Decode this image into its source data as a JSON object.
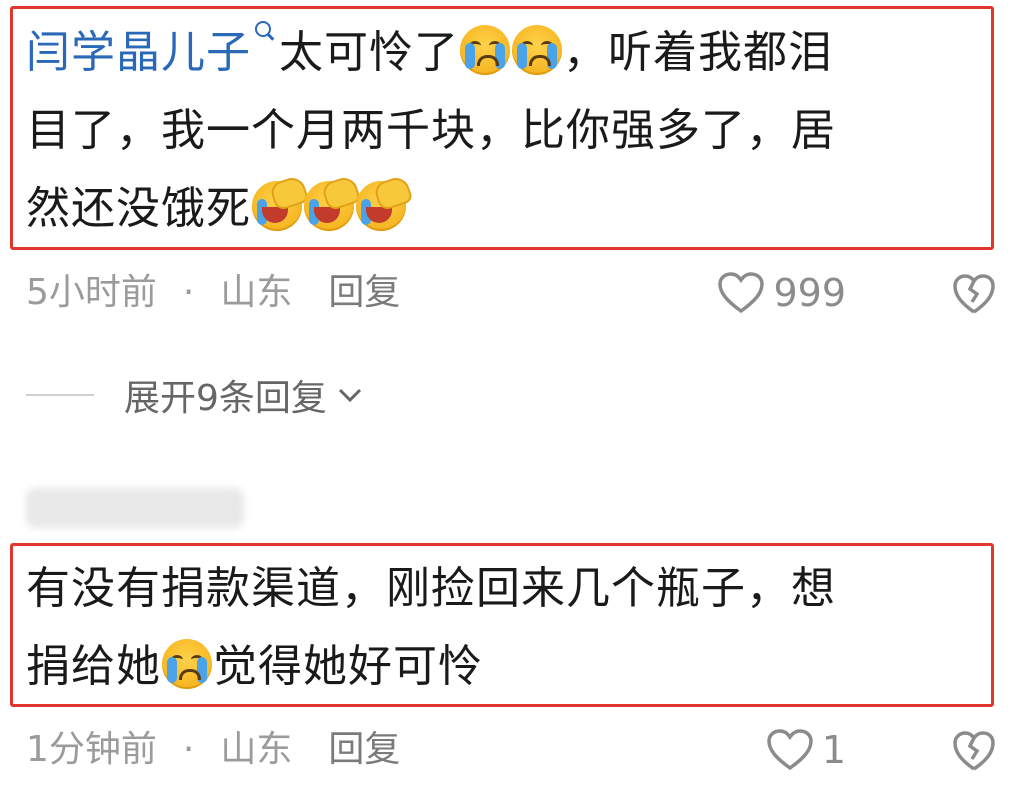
{
  "comment1": {
    "username": "闫学晶儿子",
    "line1_text": "太可怜了",
    "line1_tail": "，听着我都泪",
    "line2": "目了，我一个月两千块，比你强多了，居",
    "line3": "然还没饿死",
    "time": "5小时前",
    "location": "山东",
    "reply_label": "回复",
    "likes": "999"
  },
  "expand": {
    "label": "展开9条回复"
  },
  "comment2": {
    "line1": "有没有捐款渠道，刚捡回来几个瓶子，想",
    "line2_a": "捐给她",
    "line2_b": "觉得她好可怜",
    "time": "1分钟前",
    "location": "山东",
    "reply_label": "回复",
    "likes": "1"
  },
  "separator": "·",
  "colors": {
    "highlight_border": "#e2352f",
    "username": "#2a68b8",
    "meta_text": "#9b9b9b"
  },
  "icons": [
    "search-icon",
    "crying-emoji",
    "laughing-crying-emoji",
    "heart-icon",
    "broken-heart-icon",
    "chevron-down-icon"
  ]
}
